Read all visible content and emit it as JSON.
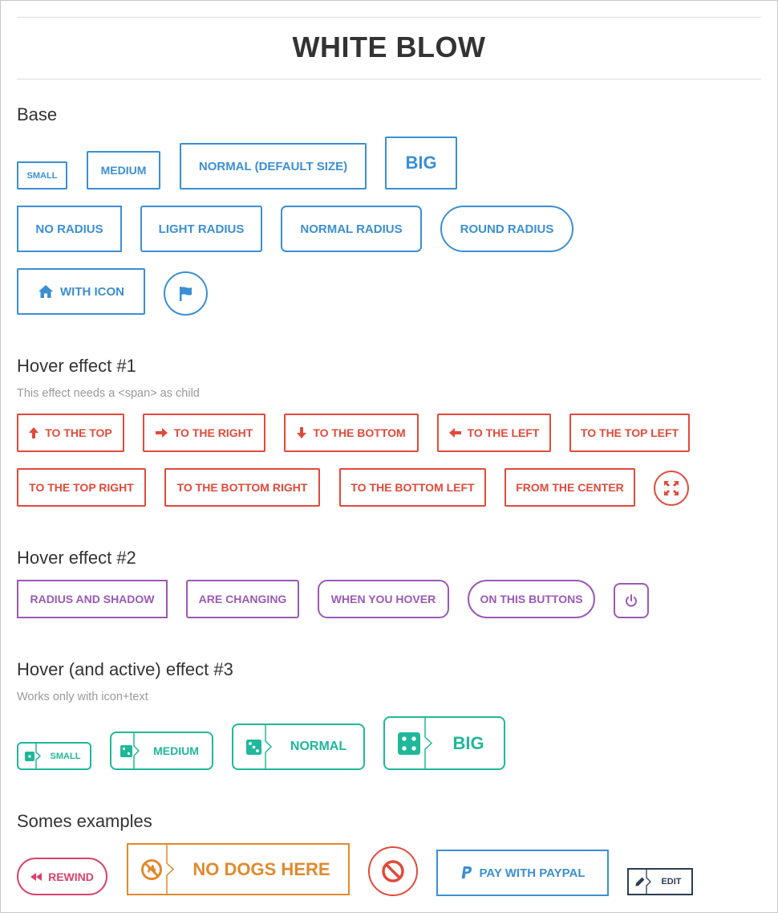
{
  "page": {
    "title": "WHITE BLOW"
  },
  "colors": {
    "blue": "#3b8fd3",
    "red": "#e04a3b",
    "purple": "#9b59b6",
    "teal": "#1fb89a",
    "pink": "#d9436b",
    "orange": "#e08a2e",
    "navy": "#2b3d52"
  },
  "base": {
    "heading": "Base",
    "sizes": [
      "SMALL",
      "MEDIUM",
      "NORMAL (DEFAULT SIZE)",
      "BIG"
    ],
    "radii": [
      "NO RADIUS",
      "LIGHT RADIUS",
      "NORMAL RADIUS",
      "ROUND RADIUS"
    ],
    "with_icon": {
      "label": "WITH ICON",
      "icon": "home-icon"
    },
    "icon_only": {
      "icon": "flag-icon"
    }
  },
  "hover1": {
    "heading": "Hover effect #1",
    "note": "This effect needs a <span> as child",
    "row1": [
      {
        "label": "TO THE TOP",
        "icon": "arrow-up-icon"
      },
      {
        "label": "TO THE RIGHT",
        "icon": "arrow-right-icon"
      },
      {
        "label": "TO THE BOTTOM",
        "icon": "arrow-down-icon"
      },
      {
        "label": "TO THE LEFT",
        "icon": "arrow-left-icon"
      },
      {
        "label": "TO THE TOP LEFT"
      }
    ],
    "row2": [
      "TO THE TOP RIGHT",
      "TO THE BOTTOM RIGHT",
      "TO THE BOTTOM LEFT",
      "FROM THE CENTER"
    ],
    "icon_only": {
      "icon": "expand-icon"
    }
  },
  "hover2": {
    "heading": "Hover effect #2",
    "buttons": [
      "RADIUS AND SHADOW",
      "ARE CHANGING",
      "WHEN YOU HOVER",
      "ON THIS BUTTONS"
    ],
    "icon_only": {
      "icon": "power-icon"
    }
  },
  "hover3": {
    "heading": "Hover (and active) effect #3",
    "note": "Works only with icon+text",
    "buttons": [
      {
        "label": "SMALL",
        "icon": "dice-one-icon"
      },
      {
        "label": "MEDIUM",
        "icon": "dice-two-icon"
      },
      {
        "label": "NORMAL",
        "icon": "dice-three-icon"
      },
      {
        "label": "BIG",
        "icon": "dice-four-icon"
      }
    ]
  },
  "examples": {
    "heading": "Somes examples",
    "rewind": {
      "label": "REWIND",
      "icon": "rewind-icon"
    },
    "no_dogs": {
      "label": "NO DOGS HERE",
      "icon": "no-dogs-icon"
    },
    "forbidden": {
      "icon": "ban-icon"
    },
    "paypal": {
      "label": "PAY WITH PAYPAL",
      "icon": "paypal-icon"
    },
    "edit": {
      "label": "EDIT",
      "icon": "pencil-icon"
    }
  }
}
